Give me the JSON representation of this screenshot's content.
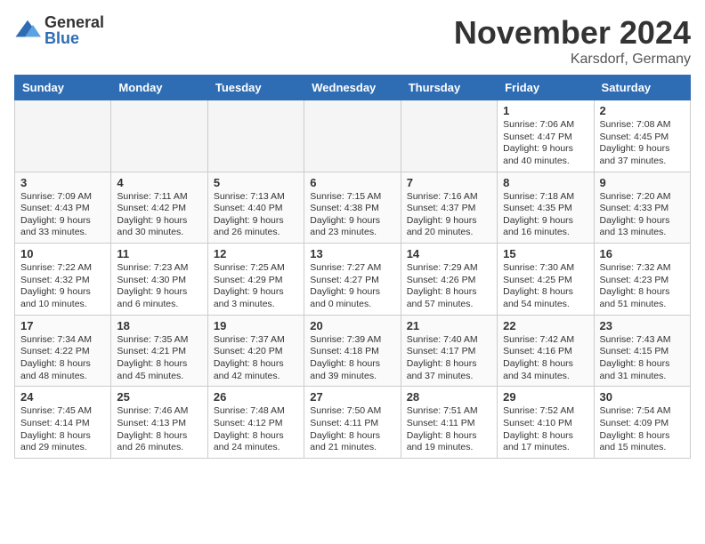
{
  "logo": {
    "general": "General",
    "blue": "Blue"
  },
  "title": "November 2024",
  "location": "Karsdorf, Germany",
  "days_header": [
    "Sunday",
    "Monday",
    "Tuesday",
    "Wednesday",
    "Thursday",
    "Friday",
    "Saturday"
  ],
  "weeks": [
    [
      {
        "day": "",
        "info": ""
      },
      {
        "day": "",
        "info": ""
      },
      {
        "day": "",
        "info": ""
      },
      {
        "day": "",
        "info": ""
      },
      {
        "day": "",
        "info": ""
      },
      {
        "day": "1",
        "info": "Sunrise: 7:06 AM\nSunset: 4:47 PM\nDaylight: 9 hours\nand 40 minutes."
      },
      {
        "day": "2",
        "info": "Sunrise: 7:08 AM\nSunset: 4:45 PM\nDaylight: 9 hours\nand 37 minutes."
      }
    ],
    [
      {
        "day": "3",
        "info": "Sunrise: 7:09 AM\nSunset: 4:43 PM\nDaylight: 9 hours\nand 33 minutes."
      },
      {
        "day": "4",
        "info": "Sunrise: 7:11 AM\nSunset: 4:42 PM\nDaylight: 9 hours\nand 30 minutes."
      },
      {
        "day": "5",
        "info": "Sunrise: 7:13 AM\nSunset: 4:40 PM\nDaylight: 9 hours\nand 26 minutes."
      },
      {
        "day": "6",
        "info": "Sunrise: 7:15 AM\nSunset: 4:38 PM\nDaylight: 9 hours\nand 23 minutes."
      },
      {
        "day": "7",
        "info": "Sunrise: 7:16 AM\nSunset: 4:37 PM\nDaylight: 9 hours\nand 20 minutes."
      },
      {
        "day": "8",
        "info": "Sunrise: 7:18 AM\nSunset: 4:35 PM\nDaylight: 9 hours\nand 16 minutes."
      },
      {
        "day": "9",
        "info": "Sunrise: 7:20 AM\nSunset: 4:33 PM\nDaylight: 9 hours\nand 13 minutes."
      }
    ],
    [
      {
        "day": "10",
        "info": "Sunrise: 7:22 AM\nSunset: 4:32 PM\nDaylight: 9 hours\nand 10 minutes."
      },
      {
        "day": "11",
        "info": "Sunrise: 7:23 AM\nSunset: 4:30 PM\nDaylight: 9 hours\nand 6 minutes."
      },
      {
        "day": "12",
        "info": "Sunrise: 7:25 AM\nSunset: 4:29 PM\nDaylight: 9 hours\nand 3 minutes."
      },
      {
        "day": "13",
        "info": "Sunrise: 7:27 AM\nSunset: 4:27 PM\nDaylight: 9 hours\nand 0 minutes."
      },
      {
        "day": "14",
        "info": "Sunrise: 7:29 AM\nSunset: 4:26 PM\nDaylight: 8 hours\nand 57 minutes."
      },
      {
        "day": "15",
        "info": "Sunrise: 7:30 AM\nSunset: 4:25 PM\nDaylight: 8 hours\nand 54 minutes."
      },
      {
        "day": "16",
        "info": "Sunrise: 7:32 AM\nSunset: 4:23 PM\nDaylight: 8 hours\nand 51 minutes."
      }
    ],
    [
      {
        "day": "17",
        "info": "Sunrise: 7:34 AM\nSunset: 4:22 PM\nDaylight: 8 hours\nand 48 minutes."
      },
      {
        "day": "18",
        "info": "Sunrise: 7:35 AM\nSunset: 4:21 PM\nDaylight: 8 hours\nand 45 minutes."
      },
      {
        "day": "19",
        "info": "Sunrise: 7:37 AM\nSunset: 4:20 PM\nDaylight: 8 hours\nand 42 minutes."
      },
      {
        "day": "20",
        "info": "Sunrise: 7:39 AM\nSunset: 4:18 PM\nDaylight: 8 hours\nand 39 minutes."
      },
      {
        "day": "21",
        "info": "Sunrise: 7:40 AM\nSunset: 4:17 PM\nDaylight: 8 hours\nand 37 minutes."
      },
      {
        "day": "22",
        "info": "Sunrise: 7:42 AM\nSunset: 4:16 PM\nDaylight: 8 hours\nand 34 minutes."
      },
      {
        "day": "23",
        "info": "Sunrise: 7:43 AM\nSunset: 4:15 PM\nDaylight: 8 hours\nand 31 minutes."
      }
    ],
    [
      {
        "day": "24",
        "info": "Sunrise: 7:45 AM\nSunset: 4:14 PM\nDaylight: 8 hours\nand 29 minutes."
      },
      {
        "day": "25",
        "info": "Sunrise: 7:46 AM\nSunset: 4:13 PM\nDaylight: 8 hours\nand 26 minutes."
      },
      {
        "day": "26",
        "info": "Sunrise: 7:48 AM\nSunset: 4:12 PM\nDaylight: 8 hours\nand 24 minutes."
      },
      {
        "day": "27",
        "info": "Sunrise: 7:50 AM\nSunset: 4:11 PM\nDaylight: 8 hours\nand 21 minutes."
      },
      {
        "day": "28",
        "info": "Sunrise: 7:51 AM\nSunset: 4:11 PM\nDaylight: 8 hours\nand 19 minutes."
      },
      {
        "day": "29",
        "info": "Sunrise: 7:52 AM\nSunset: 4:10 PM\nDaylight: 8 hours\nand 17 minutes."
      },
      {
        "day": "30",
        "info": "Sunrise: 7:54 AM\nSunset: 4:09 PM\nDaylight: 8 hours\nand 15 minutes."
      }
    ]
  ]
}
